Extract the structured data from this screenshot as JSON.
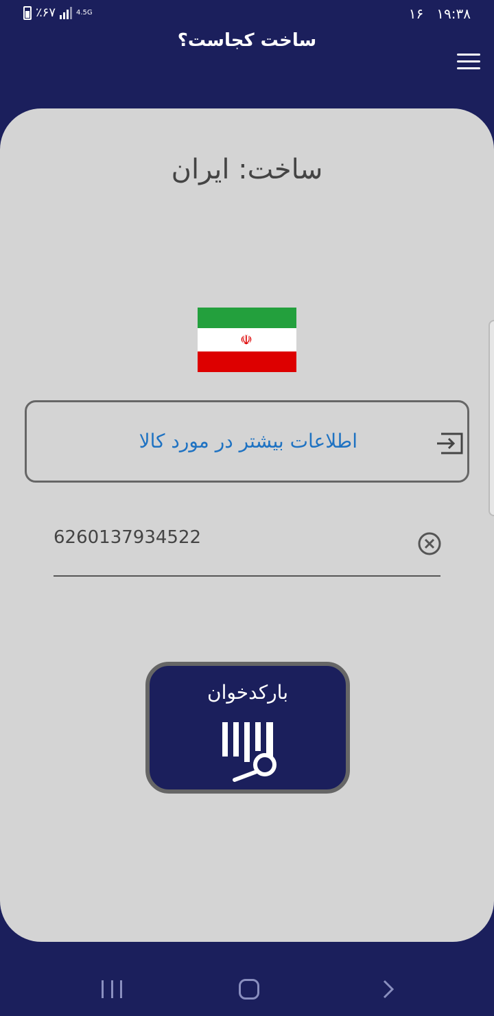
{
  "status_bar": {
    "time": "۱۹:۳۸",
    "date_day": "۱۶",
    "battery": "٪۶۷",
    "network": "4.5G"
  },
  "header": {
    "title": "ساخت کجاست؟",
    "menu_icon": "hamburger-menu-icon"
  },
  "result": {
    "made_in_label": "ساخت: ایران",
    "country": "ایران",
    "flag_colors": [
      "#23a03d",
      "#ffffff",
      "#dd0000"
    ],
    "flag_emblem": "☫"
  },
  "more_info_button": {
    "label": "اطلاعات بیشتر در مورد کالا",
    "icon": "login-icon",
    "color": "#1e72c2"
  },
  "barcode_input": {
    "value": "6260137934522",
    "clear_icon": "clear-circle-icon"
  },
  "scanner_button": {
    "label": "بارکدخوان",
    "icon": "barcode-search-icon"
  },
  "nav_bar": {
    "recent": "recent-apps-icon",
    "home": "home-icon",
    "back": "back-icon"
  },
  "colors": {
    "primary": "#1b1f5c",
    "card_bg": "#d4d4d4"
  }
}
